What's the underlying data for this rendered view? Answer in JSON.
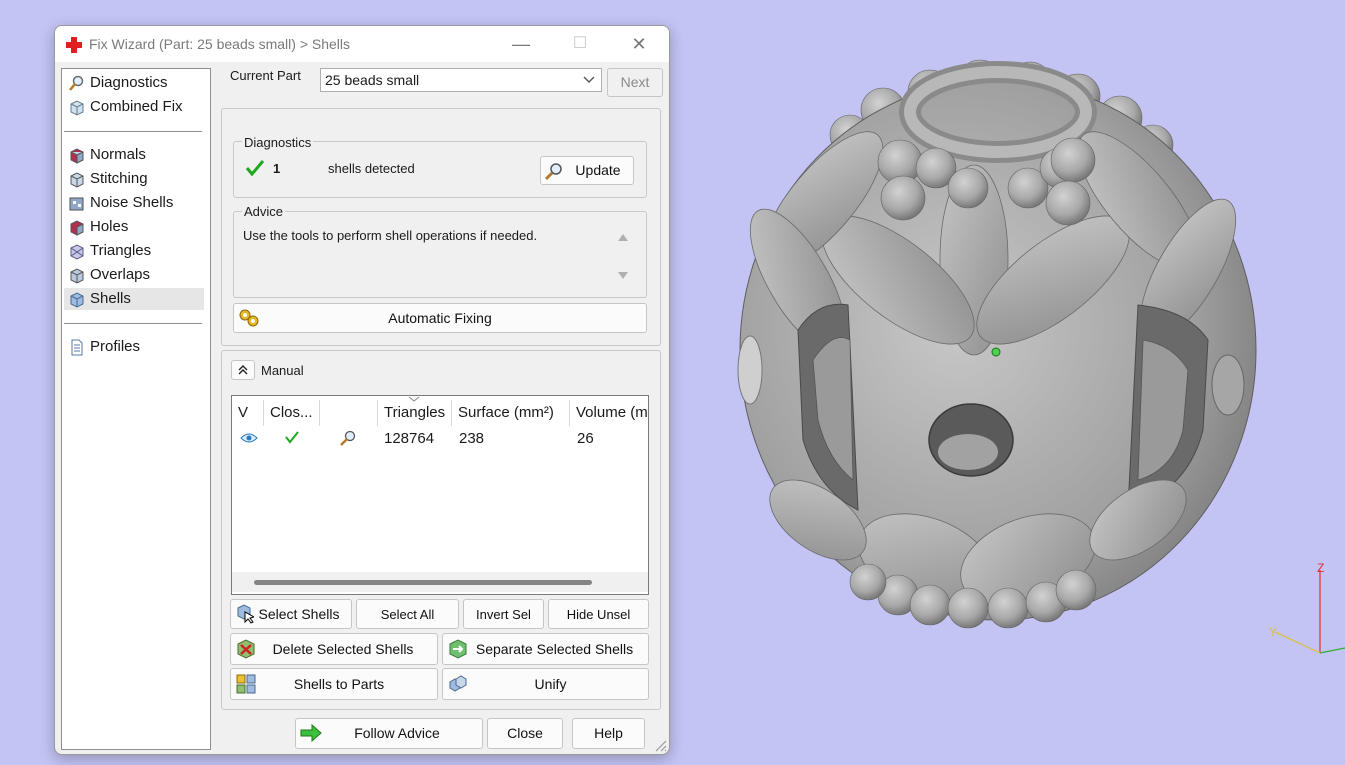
{
  "window": {
    "title": "Fix Wizard (Part: 25 beads small) > Shells",
    "controls": {
      "minimize": "—",
      "maximize": "☐",
      "close": "✕"
    }
  },
  "sidebar": {
    "items": [
      {
        "label": "Diagnostics",
        "icon": "magnifier-icon"
      },
      {
        "label": "Combined Fix",
        "icon": "cube-icon"
      },
      {
        "label": "Normals",
        "icon": "normals-icon"
      },
      {
        "label": "Stitching",
        "icon": "stitching-icon"
      },
      {
        "label": "Noise Shells",
        "icon": "noise-shells-icon"
      },
      {
        "label": "Holes",
        "icon": "holes-icon"
      },
      {
        "label": "Triangles",
        "icon": "triangles-icon"
      },
      {
        "label": "Overlaps",
        "icon": "overlaps-icon"
      },
      {
        "label": "Shells",
        "icon": "shells-icon"
      },
      {
        "label": "Profiles",
        "icon": "document-icon"
      }
    ],
    "selected": "Shells"
  },
  "header": {
    "current_part_label": "Current Part",
    "current_part_value": "25 beads small",
    "next_label": "Next"
  },
  "diagnostics": {
    "title": "Diagnostics",
    "count": "1",
    "status_text": "shells detected",
    "update_label": "Update"
  },
  "advice": {
    "title": "Advice",
    "text": "Use the tools to perform shell operations if needed."
  },
  "auto_fix_label": "Automatic Fixing",
  "manual": {
    "title": "Manual",
    "columns": [
      "V",
      "Clos...",
      "",
      "Triangles",
      "Surface (mm²)",
      "Volume (m"
    ],
    "rows": [
      {
        "visible": "eye-icon",
        "closed": "check-icon",
        "detail": "magnifier-icon",
        "triangles": "128764",
        "surface": "238",
        "volume": "26"
      }
    ],
    "buttons": {
      "select_shells": "Select Shells",
      "select_all": "Select All",
      "invert_sel": "Invert Sel",
      "hide_unsel": "Hide Unsel",
      "delete_selected": "Delete Selected Shells",
      "separate_selected": "Separate Selected Shells",
      "shells_to_parts": "Shells to Parts",
      "unify": "Unify"
    }
  },
  "footer": {
    "follow_advice": "Follow Advice",
    "close": "Close",
    "help": "Help"
  },
  "viewport": {
    "background": "#c3c3f4",
    "axis_label_z": "Z",
    "axis_label_y": "Y",
    "model": "bead-3d-model"
  },
  "colors": {
    "accent_check": "#1ea81e",
    "axis_z": "#e03030",
    "axis_x": "#30b030",
    "axis_y": "#e0c030"
  }
}
